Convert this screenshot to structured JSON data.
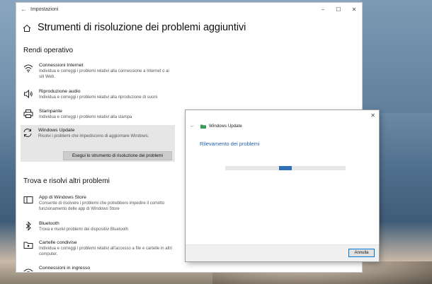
{
  "window": {
    "app_title": "Impostazioni",
    "controls": {
      "minimize": "–",
      "maximize": "☐",
      "close": "✕"
    },
    "page_title": "Strumenti di risoluzione dei problemi aggiuntivi"
  },
  "section_run": {
    "title": "Rendi operativo",
    "items": [
      {
        "name": "Connessioni Internet",
        "desc": "Individua e correggi i problemi relativi alla connessione a Internet o ai siti Web.",
        "icon": "wifi-icon"
      },
      {
        "name": "Riproduzione audio",
        "desc": "Individua e correggi i problemi relativi alla riproduzione di suoni",
        "icon": "speaker-icon"
      },
      {
        "name": "Stampante",
        "desc": "Individua e correggi i problemi relativi alla stampa",
        "icon": "printer-icon"
      },
      {
        "name": "Windows Update",
        "desc": "Risolvi i problemi che impediscono di aggiornare Windows.",
        "icon": "update-icon"
      }
    ],
    "run_button": "Esegui lo strumento di risoluzione dei problemi"
  },
  "section_other": {
    "title": "Trova e risolvi altri problemi",
    "items": [
      {
        "name": "App di Windows Store",
        "desc": "Consente di risolvere i problemi che potrebbero impedire il corretto funzionamento delle app di Windows Store",
        "icon": "store-icon"
      },
      {
        "name": "Bluetooth",
        "desc": "Trova e risolvi problemi dei dispositivi Bluetooth",
        "icon": "bluetooth-icon"
      },
      {
        "name": "Cartelle condivise",
        "desc": "Individua e correggi i problemi relativi all'accesso a file e cartelle in altri computer.",
        "icon": "shared-folder-icon"
      },
      {
        "name": "Connessioni in ingresso",
        "desc": "",
        "icon": "incoming-connection-icon"
      }
    ]
  },
  "dialog": {
    "title": "Windows Update",
    "status": "Rilevamento dei problemi",
    "cancel": "Annulla",
    "progress_fraction": 0.5
  },
  "colors": {
    "accent": "#2e71b8",
    "status_text": "#1f5fa8"
  }
}
